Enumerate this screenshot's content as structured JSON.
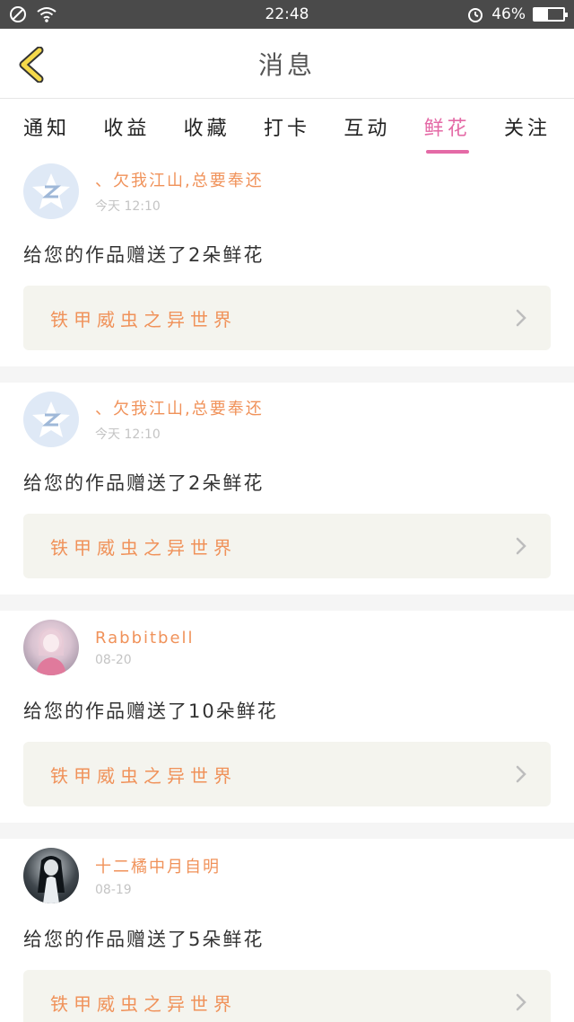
{
  "status_bar": {
    "time": "22:48",
    "battery": "46%",
    "battery_level": 0.46
  },
  "header": {
    "title": "消息",
    "back_icon": "chevron-left-icon"
  },
  "tabs": [
    {
      "label": "通知"
    },
    {
      "label": "收益"
    },
    {
      "label": "收藏"
    },
    {
      "label": "打卡"
    },
    {
      "label": "互动"
    },
    {
      "label": "鲜花",
      "active": true
    },
    {
      "label": "关注"
    }
  ],
  "colors": {
    "accent": "#e46aa6",
    "name_orange": "#f0925a",
    "status_bg": "#4a4a4a",
    "card_bg": "#f4f4ee"
  },
  "messages": [
    {
      "user": "、欠我江山,总要奉还",
      "time": "今天 12:10",
      "text": "给您的作品赠送了2朵鲜花",
      "work": "铁甲威虫之异世界",
      "avatar": "qq-default-avatar"
    },
    {
      "user": "、欠我江山,总要奉还",
      "time": "今天 12:10",
      "text": "给您的作品赠送了2朵鲜花",
      "work": "铁甲威虫之异世界",
      "avatar": "qq-default-avatar"
    },
    {
      "user": "Rabbitbell",
      "time": "08-20",
      "text": "给您的作品赠送了10朵鲜花",
      "work": "铁甲威虫之异世界",
      "avatar": "photo-avatar"
    },
    {
      "user": "十二橘中月自明",
      "time": "08-19",
      "text": "给您的作品赠送了5朵鲜花",
      "work": "铁甲威虫之异世界",
      "avatar": "photo-avatar"
    }
  ]
}
